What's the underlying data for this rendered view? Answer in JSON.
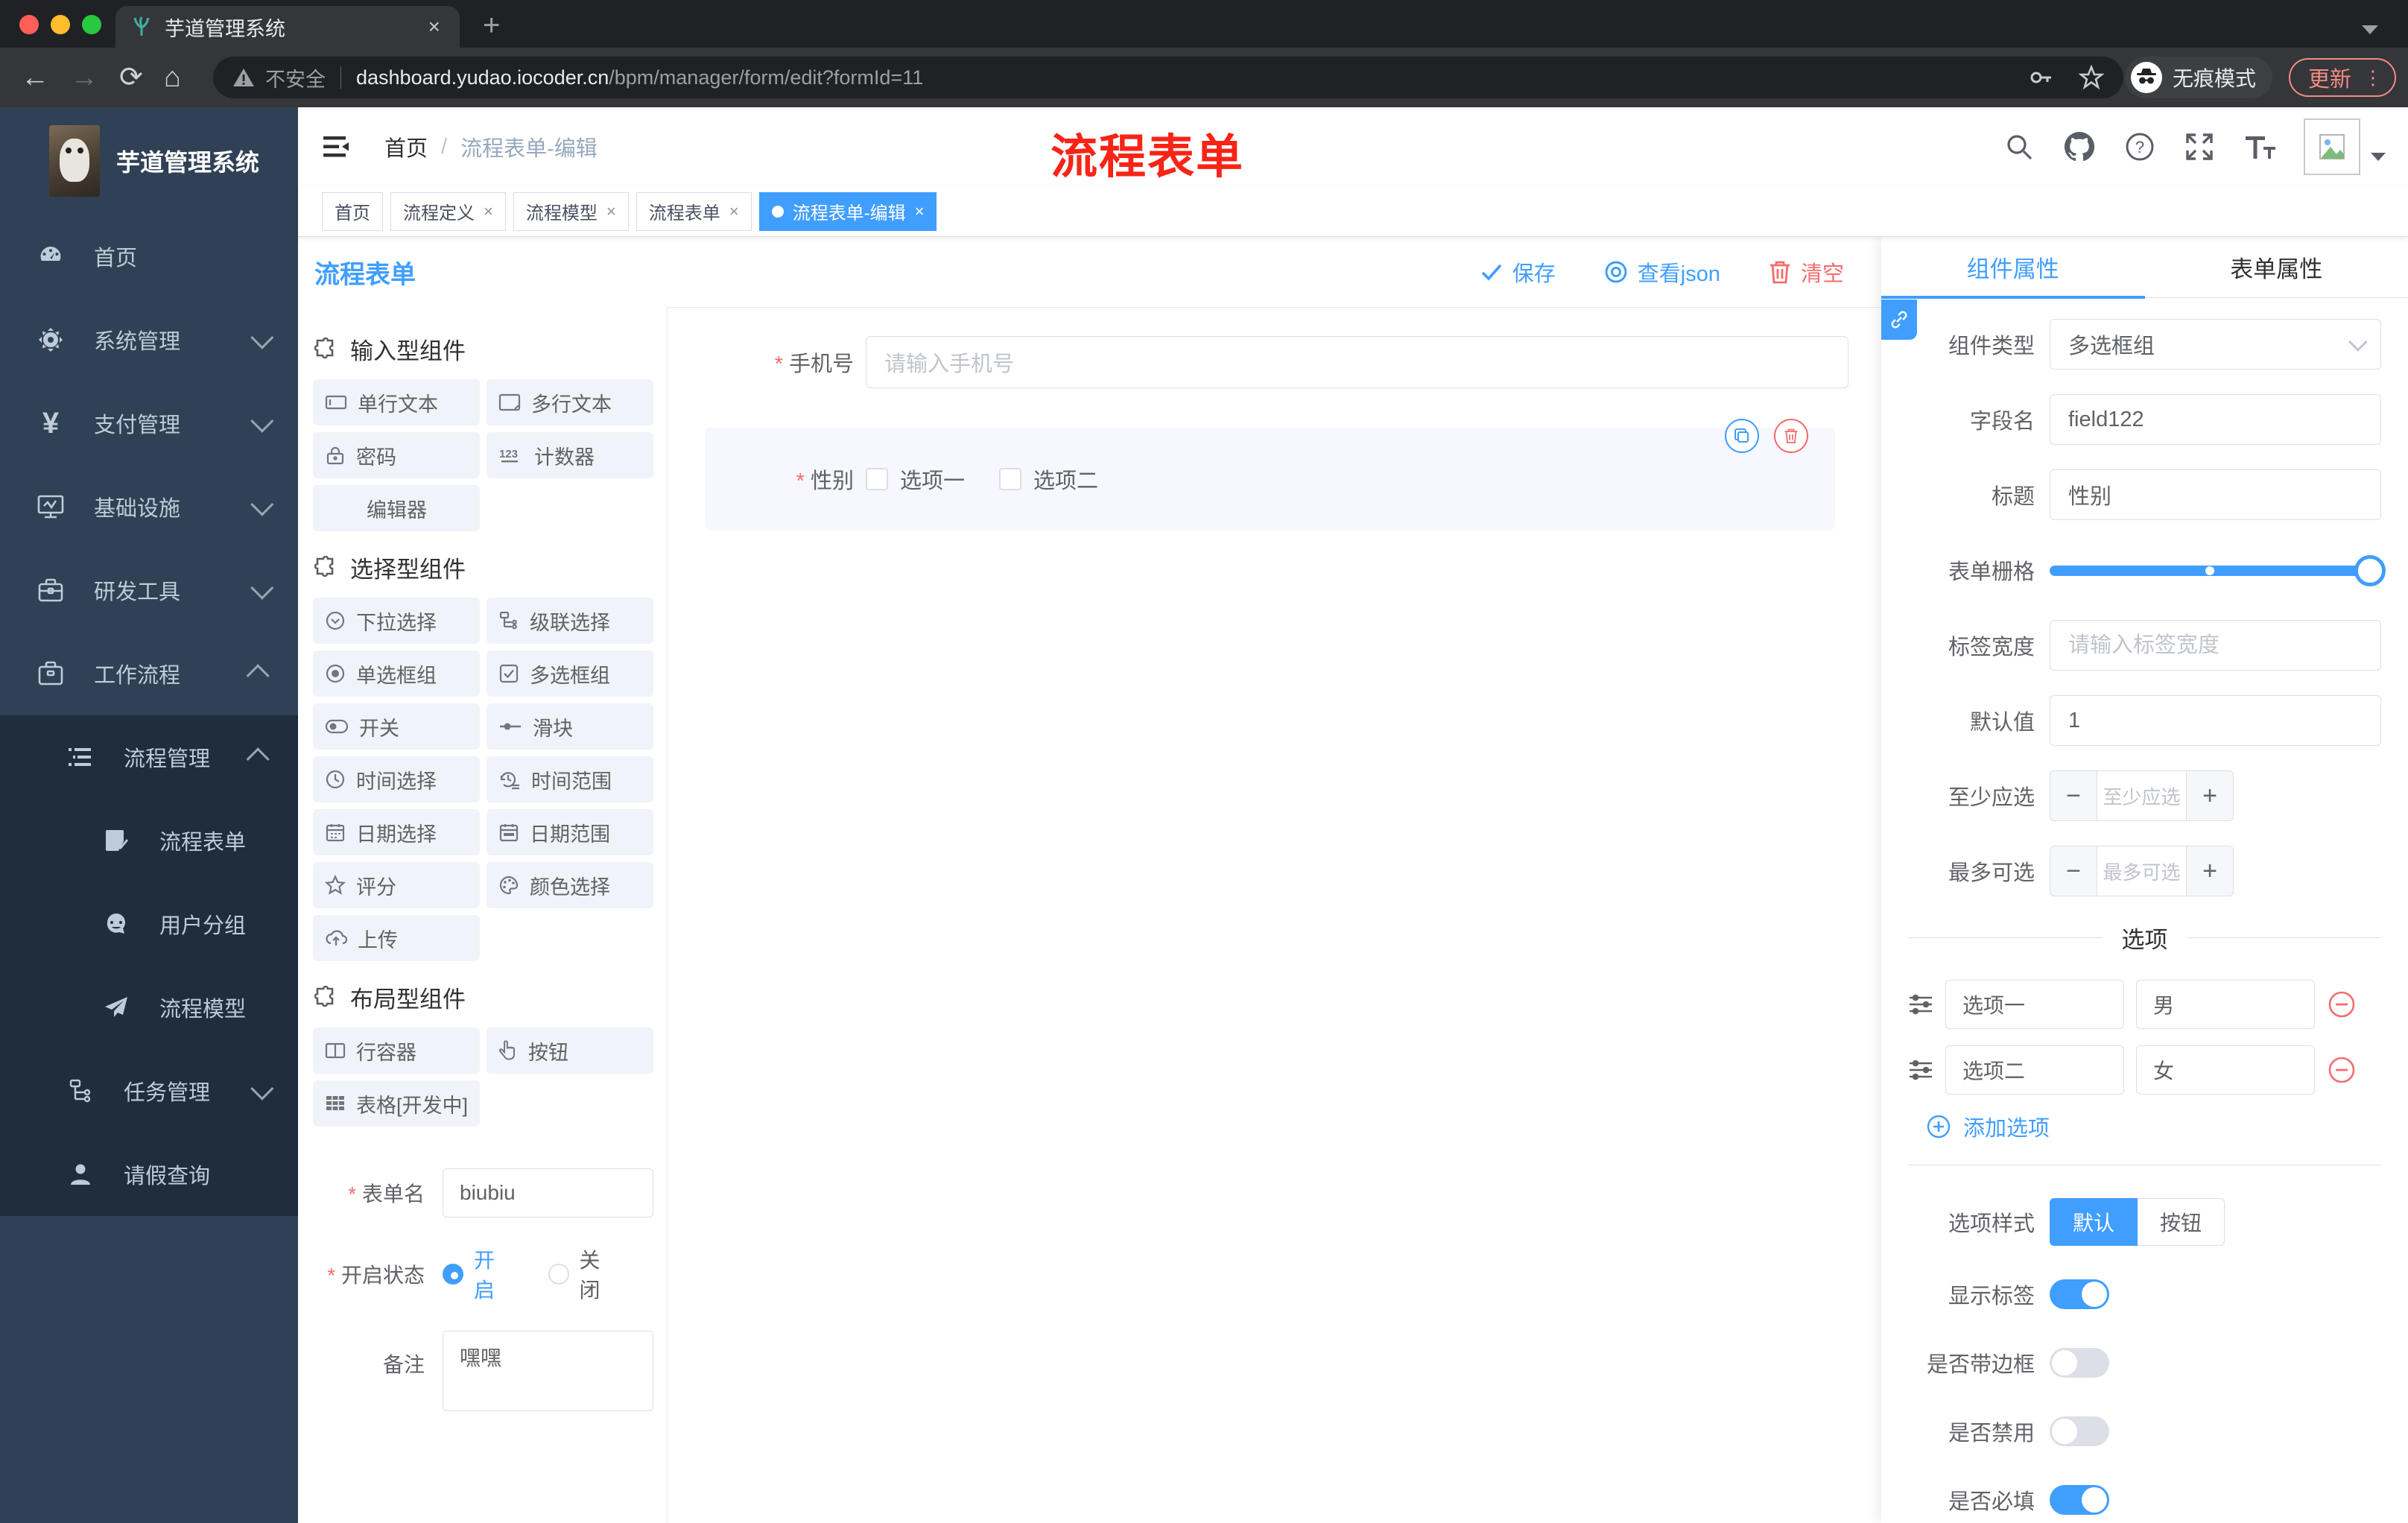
{
  "chrome": {
    "tab_title": "芋道管理系统",
    "security_text": "不安全",
    "url_host": "dashboard.yudao.iocoder.cn",
    "url_path": "/bpm/manager/form/edit?formId=11",
    "incognito_label": "无痕模式",
    "update_label": "更新"
  },
  "sidebar": {
    "title": "芋道管理系统",
    "menu": [
      {
        "label": "首页",
        "icon": "dashboard-icon"
      },
      {
        "label": "系统管理",
        "icon": "gear-icon"
      },
      {
        "label": "支付管理",
        "icon": "yen-icon"
      },
      {
        "label": "基础设施",
        "icon": "monitor-icon"
      },
      {
        "label": "研发工具",
        "icon": "toolbox-icon"
      },
      {
        "label": "工作流程",
        "icon": "briefcase-icon"
      }
    ],
    "submenu": {
      "label": "流程管理",
      "icon": "list-icon"
    },
    "submenu_children": [
      {
        "label": "流程表单",
        "icon": "form-doc-icon"
      },
      {
        "label": "用户分组",
        "icon": "robot-icon"
      },
      {
        "label": "流程模型",
        "icon": "paper-plane-icon"
      }
    ],
    "submenu_tail": [
      {
        "label": "任务管理",
        "icon": "tree-icon"
      },
      {
        "label": "请假查询",
        "icon": "user-icon"
      }
    ]
  },
  "header": {
    "breadcrumb_home": "首页",
    "breadcrumb_current": "流程表单-编辑",
    "watermark": "流程表单"
  },
  "tags": [
    {
      "label": "首页"
    },
    {
      "label": "流程定义"
    },
    {
      "label": "流程模型"
    },
    {
      "label": "流程表单"
    },
    {
      "label": "流程表单-编辑"
    }
  ],
  "toolbar": {
    "title": "流程表单",
    "save": "保存",
    "view_json": "查看json",
    "clear": "清空"
  },
  "components": {
    "section1": {
      "title": "输入型组件",
      "items": [
        {
          "label": "单行文本"
        },
        {
          "label": "多行文本"
        },
        {
          "label": "密码"
        },
        {
          "label": "计数器"
        },
        {
          "label": "编辑器"
        }
      ]
    },
    "section2": {
      "title": "选择型组件",
      "items": [
        {
          "label": "下拉选择"
        },
        {
          "label": "级联选择"
        },
        {
          "label": "单选框组"
        },
        {
          "label": "多选框组"
        },
        {
          "label": "开关"
        },
        {
          "label": "滑块"
        },
        {
          "label": "时间选择"
        },
        {
          "label": "时间范围"
        },
        {
          "label": "日期选择"
        },
        {
          "label": "日期范围"
        },
        {
          "label": "评分"
        },
        {
          "label": "颜色选择"
        },
        {
          "label": "上传"
        }
      ]
    },
    "section3": {
      "title": "布局型组件",
      "items": [
        {
          "label": "行容器"
        },
        {
          "label": "按钮"
        },
        {
          "label": "表格[开发中]"
        }
      ]
    }
  },
  "left_form": {
    "name_label": "表单名",
    "name_value": "biubiu",
    "status_label": "开启状态",
    "status_on": "开启",
    "status_off": "关闭",
    "remark_label": "备注",
    "remark_value": "嘿嘿"
  },
  "canvas": {
    "phone_label": "手机号",
    "phone_placeholder": "请输入手机号",
    "gender_label": "性别",
    "gender_option1": "选项一",
    "gender_option2": "选项二"
  },
  "props": {
    "tab_component": "组件属性",
    "tab_form": "表单属性",
    "type_label": "组件类型",
    "type_value": "多选框组",
    "field_label": "字段名",
    "field_value": "field122",
    "title_label": "标题",
    "title_value": "性别",
    "grid_label": "表单栅格",
    "labelwidth_label": "标签宽度",
    "labelwidth_placeholder": "请输入标签宽度",
    "default_label": "默认值",
    "default_value": "1",
    "min_label": "至少应选",
    "min_placeholder": "至少应选",
    "max_label": "最多可选",
    "max_placeholder": "最多可选",
    "options_divider": "选项",
    "options": [
      {
        "label": "选项一",
        "value": "男"
      },
      {
        "label": "选项二",
        "value": "女"
      }
    ],
    "add_option": "添加选项",
    "style_label": "选项样式",
    "style_default": "默认",
    "style_button": "按钮",
    "toggle_showlabel": "显示标签",
    "toggle_border": "是否带边框",
    "toggle_disabled": "是否禁用",
    "toggle_required": "是否必填"
  },
  "colors": {
    "accent": "#409eff",
    "danger": "#f56c6c",
    "sidebar_bg": "#304156",
    "submenu_bg": "#1f2d3d",
    "watermark_red": "#f82416"
  }
}
